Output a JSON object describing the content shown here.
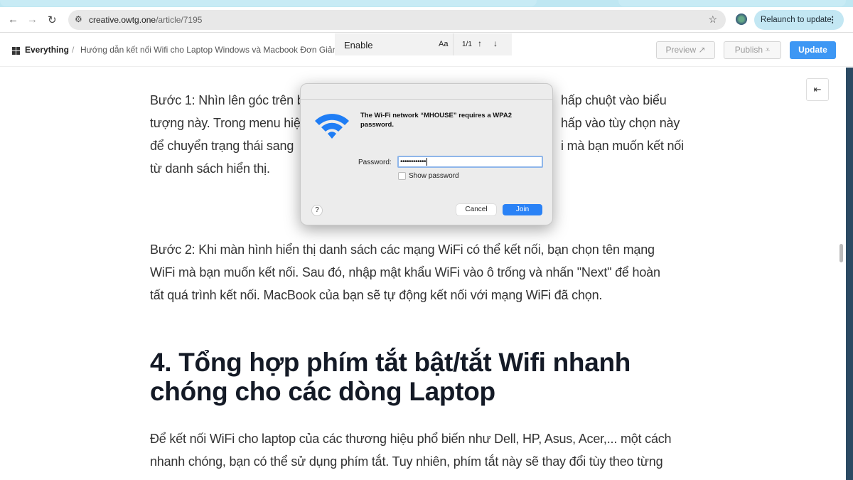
{
  "browser": {
    "url_host": "creative.owtg.one",
    "url_path": "/article/7195",
    "relaunch_label": "Relaunch to update"
  },
  "app": {
    "breadcrumb_root": "Everything",
    "breadcrumb_sep": "/",
    "breadcrumb_page": "Hướng dẫn kết nối Wifi cho Laptop Windows và Macbook Đơn Giản",
    "find": {
      "query": "Enable",
      "match_case": "Aa",
      "count": "1/1"
    },
    "buttons": {
      "preview": "Preview",
      "publish": "Publish",
      "update": "Update"
    }
  },
  "article": {
    "p1_left": [
      "Bước 1: Nhìn lên góc trên b",
      "tượng này. Trong menu hiệ",
      "để chuyển trạng thái sang",
      "từ danh sách hiển thị."
    ],
    "p1_right": [
      "hấp chuột vào biểu",
      "hấp vào tùy chọn này",
      "i mà bạn muốn kết nối"
    ],
    "p2": [
      "Bước 2: Khi màn hình hiển thị danh sách các mạng WiFi có thể kết nối, bạn chọn tên mạng",
      "WiFi mà bạn muốn kết nối. Sau đó, nhập mật khẩu WiFi vào ô trống và nhấn \"Next\" để hoàn",
      "tất quá trình kết nối. MacBook của bạn sẽ tự động kết nối với mạng WiFi đã chọn."
    ],
    "heading": [
      "4. Tổng hợp phím tắt bật/tắt Wifi nhanh",
      "chóng cho các dòng Laptop"
    ],
    "p3": [
      "Để kết nối WiFi cho laptop của các thương hiệu phổ biến như Dell, HP, Asus, Acer,... một cách",
      "nhanh chóng, bạn có thể sử dụng phím tắt. Tuy nhiên, phím tắt này sẽ thay đổi tùy theo từng"
    ]
  },
  "dialog": {
    "message": "The Wi-Fi network “MHOUSE” requires a WPA2 password.",
    "password_label": "Password:",
    "password_value": "••••••••••••",
    "show_password": "Show password",
    "help": "?",
    "cancel": "Cancel",
    "join": "Join",
    "accent": "#2a82f6"
  }
}
